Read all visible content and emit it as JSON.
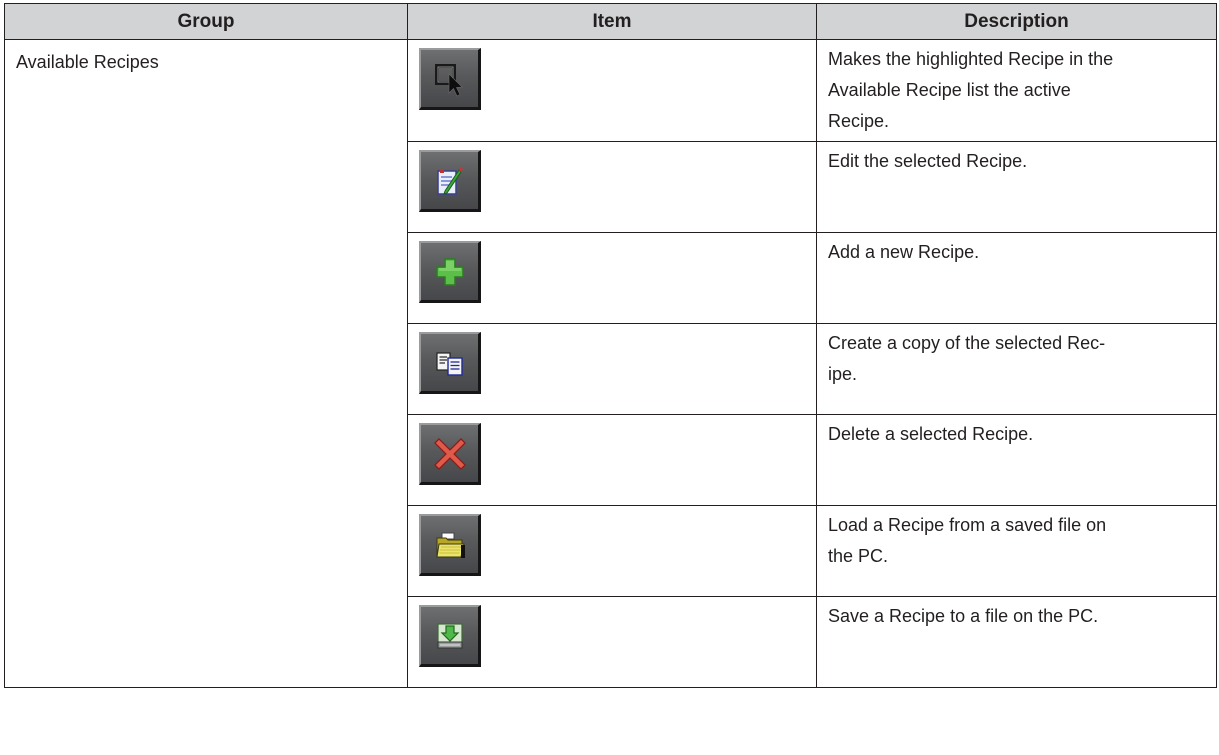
{
  "table": {
    "headers": {
      "group": "Group",
      "item": "Item",
      "description": "Description"
    },
    "group_name": "Available Recipes",
    "rows": [
      {
        "icon": "select-cursor-icon",
        "description_lines": [
          "Makes the highlighted Recipe in the",
          "Available Recipe list the active",
          "Recipe."
        ]
      },
      {
        "icon": "edit-pencil-icon",
        "description_lines": [
          "Edit the selected Recipe."
        ]
      },
      {
        "icon": "add-plus-icon",
        "description_lines": [
          "Add a new Recipe."
        ]
      },
      {
        "icon": "copy-documents-icon",
        "description_lines": [
          "Create a copy of the selected Rec-",
          "ipe."
        ]
      },
      {
        "icon": "delete-x-icon",
        "description_lines": [
          "Delete a selected Recipe."
        ]
      },
      {
        "icon": "open-folder-icon",
        "description_lines": [
          "Load a Recipe from a saved file on",
          "the PC."
        ]
      },
      {
        "icon": "save-download-icon",
        "description_lines": [
          "Save a Recipe to a file on the PC."
        ]
      }
    ]
  }
}
